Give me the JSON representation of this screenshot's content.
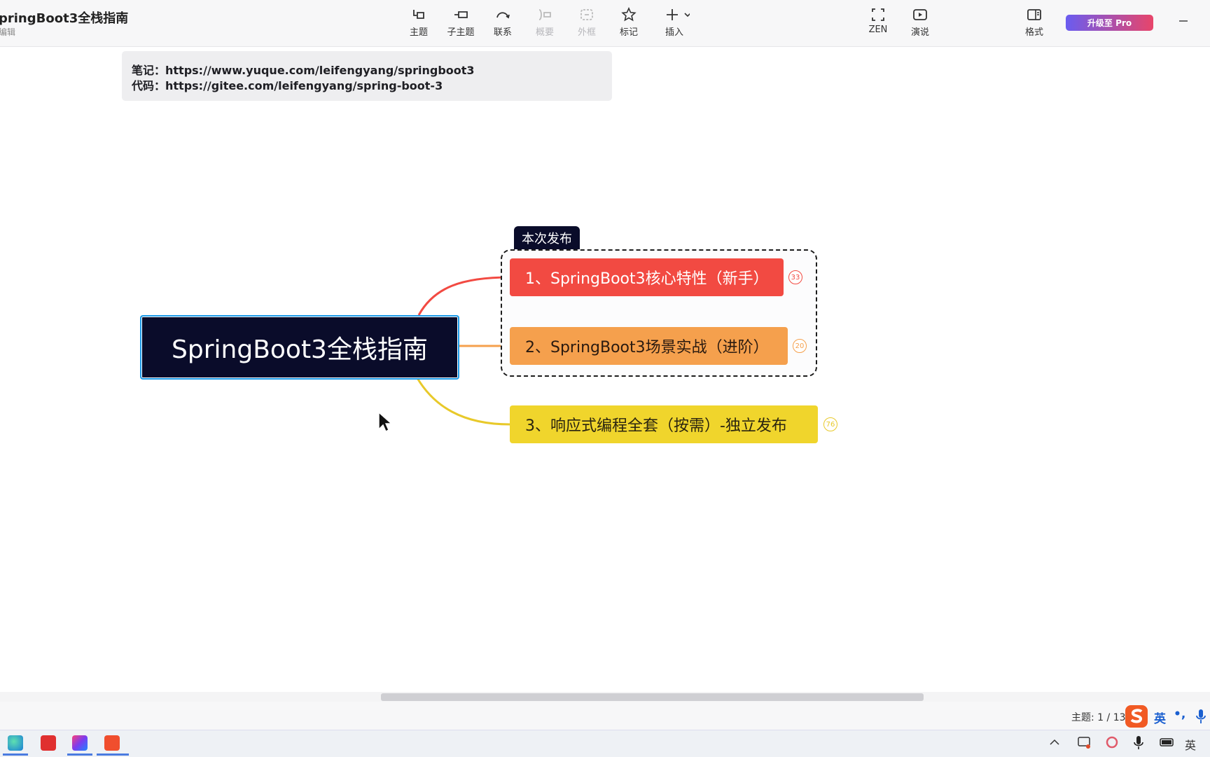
{
  "app": {
    "doc_title": "pringBoot3全栈指南",
    "doc_subtitle": "编辑",
    "upgrade_label": "升级至 Pro"
  },
  "toolbar": {
    "tools": [
      {
        "label": "主题",
        "icon": "topic-icon"
      },
      {
        "label": "子主题",
        "icon": "subtopic-icon"
      },
      {
        "label": "联系",
        "icon": "relationship-icon"
      },
      {
        "label": "概要",
        "icon": "summary-icon",
        "disabled": true
      },
      {
        "label": "外框",
        "icon": "boundary-icon",
        "disabled": true
      },
      {
        "label": "标记",
        "icon": "star-icon"
      },
      {
        "label": "插入",
        "icon": "plus-icon"
      },
      {
        "label": "ZEN",
        "icon": "fullscreen-icon"
      },
      {
        "label": "演说",
        "icon": "play-icon"
      },
      {
        "label": "格式",
        "icon": "panel-icon"
      }
    ]
  },
  "note": {
    "line1": "笔记：https://www.yuque.com/leifengyang/springboot3",
    "line2": "代码：https://gitee.com/leifengyang/spring-boot-3"
  },
  "mindmap": {
    "root": "SpringBoot3全栈指南",
    "boundary_label": "本次发布",
    "topics": [
      {
        "label": "1、SpringBoot3核心特性（新手）",
        "count": "33",
        "color": "#f24a42"
      },
      {
        "label": "2、SpringBoot3场景实战（进阶）",
        "count": "20",
        "color": "#f5a04d"
      },
      {
        "label": "3、响应式编程全套（按需）-独立发布",
        "count": "76",
        "color": "#f0d52c"
      }
    ]
  },
  "status": {
    "topic_count": "主题: 1 / 13"
  },
  "tray": {
    "ime_lang": "英",
    "ime_punct": "•,",
    "ime_mode": "英"
  }
}
